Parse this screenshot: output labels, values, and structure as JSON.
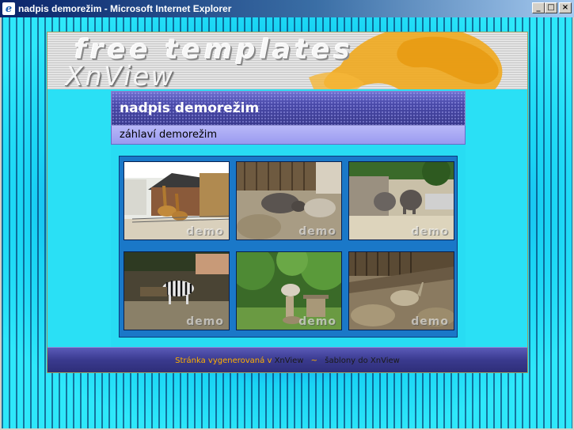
{
  "window": {
    "title": "nadpis demorežim - Microsoft Internet Explorer",
    "icon": "ie-icon",
    "controls": {
      "minimize": "_",
      "maximize": "□",
      "close": "×"
    }
  },
  "banner": {
    "line1": "free templates",
    "line2": "XnView"
  },
  "page": {
    "title": "nadpis demorežim",
    "subtitle": "záhlaví demorežim"
  },
  "gallery": {
    "watermark": "demo",
    "thumbnails": [
      {
        "subject": "giraffes"
      },
      {
        "subject": "rhinoceros"
      },
      {
        "subject": "elephants"
      },
      {
        "subject": "zebra"
      },
      {
        "subject": "bird"
      },
      {
        "subject": "ostrich"
      }
    ]
  },
  "footer": {
    "prefix": "Stránka vygenerovaná v",
    "link1": "XnView",
    "separator": "~",
    "link2": "šablony do XnView"
  },
  "colors": {
    "title_bar": "#38388c",
    "subtitle_bar": "#9a9af0",
    "frame_bg": "#2ae0f5",
    "footer_text": "#ffb000"
  }
}
